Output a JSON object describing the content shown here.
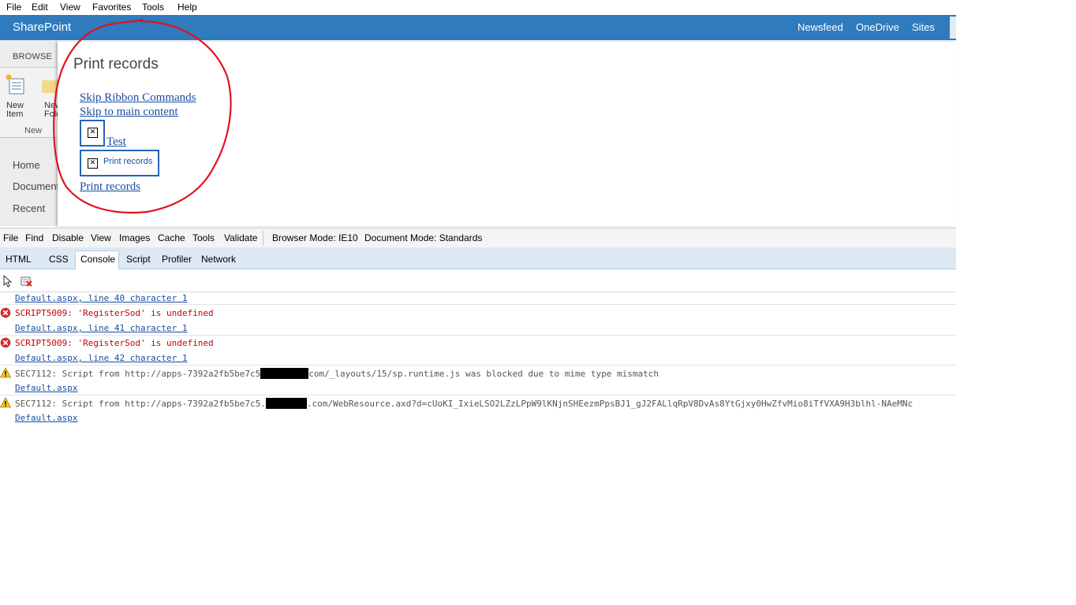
{
  "ie_menu": [
    "File",
    "Edit",
    "View",
    "Favorites",
    "Tools",
    "Help"
  ],
  "suite_bar": {
    "brand": "SharePoint",
    "links": [
      "Newsfeed",
      "OneDrive",
      "Sites"
    ]
  },
  "ribbon": {
    "tab": "BROWSE",
    "new_item": "New Item",
    "new_folder": "New Folder",
    "group": "New"
  },
  "quick_launch": [
    "Home",
    "Documents",
    "Recent"
  ],
  "dialog": {
    "title": "Print records",
    "skip_ribbon": "Skip Ribbon Commands",
    "skip_main": "Skip to main content",
    "test_link": "Test",
    "print_button": "Print records",
    "print_link": "Print records"
  },
  "devtools": {
    "menu": [
      "File",
      "Find",
      "Disable",
      "View",
      "Images",
      "Cache",
      "Tools",
      "Validate"
    ],
    "browser_mode": "Browser Mode: IE10",
    "document_mode": "Document Mode: Standards",
    "tabs": [
      "HTML",
      "CSS",
      "Console",
      "Script",
      "Profiler",
      "Network"
    ],
    "active_tab": "Console",
    "console": [
      {
        "type": "link",
        "text": "Default.aspx, line 40 character 1"
      },
      {
        "type": "error",
        "text": "SCRIPT5009: 'RegisterSod' is undefined"
      },
      {
        "type": "link",
        "text": "Default.aspx, line 41 character 1"
      },
      {
        "type": "error",
        "text": "SCRIPT5009: 'RegisterSod' is undefined"
      },
      {
        "type": "link",
        "text": "Default.aspx, line 42 character 1"
      },
      {
        "type": "warning",
        "text_before": "SEC7112: Script from http://apps-7392a2fb5be7c5",
        "text_after": "com/_layouts/15/sp.runtime.js was blocked due to mime type mismatch"
      },
      {
        "type": "link",
        "text": "Default.aspx"
      },
      {
        "type": "warning",
        "text_before": "SEC7112: Script from http://apps-7392a2fb5be7c5.",
        "text_after": ".com/WebResource.axd?d=cUoKI_IxieLSO2LZzLPpW9lKNjnSHEezmPpsBJ1_gJ2FALlqRpV8DvAs8YtGjxy0HwZfvMio8iTfVXA9H3blhl-NAeMNc"
      },
      {
        "type": "link",
        "text": "Default.aspx"
      }
    ]
  },
  "colors": {
    "suite_bar": "#2f7bbd",
    "link": "#1a4fa0",
    "error": "#cc0000",
    "annotation": "#e0141e"
  }
}
